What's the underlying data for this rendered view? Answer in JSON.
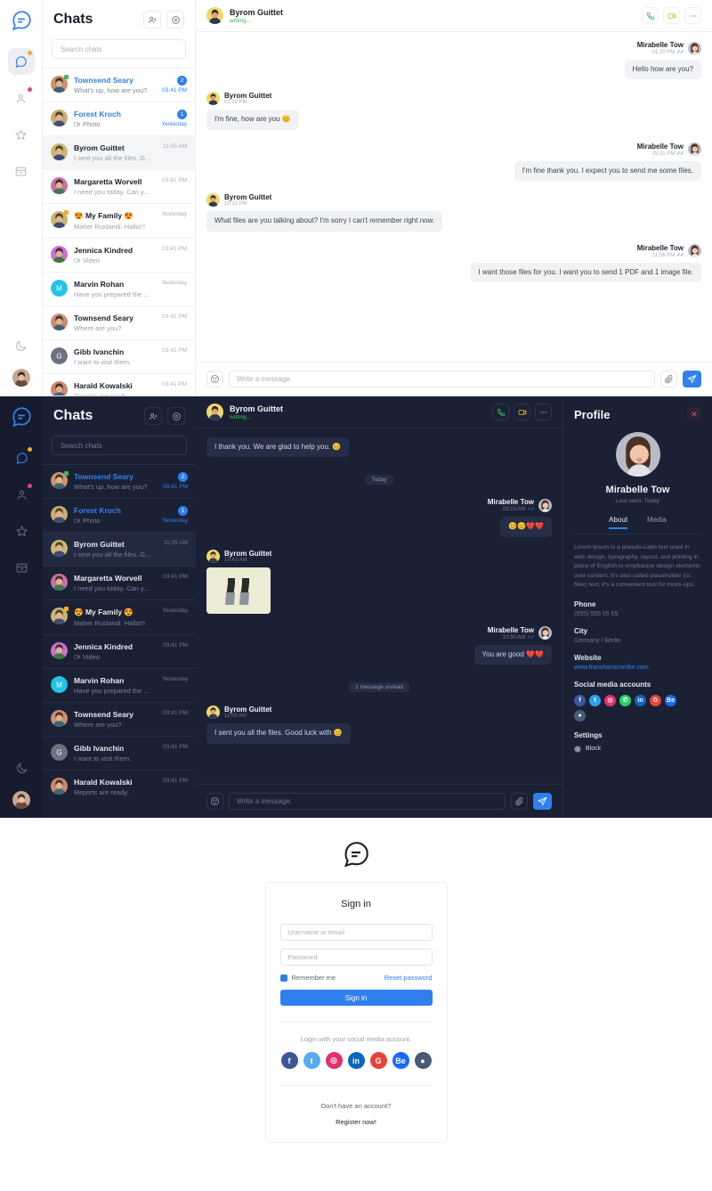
{
  "brand": {
    "accent": "#2f80ed",
    "online": "#3fb95c",
    "danger": "#e25563"
  },
  "rail": {
    "logo_icon": "chat-logo-icon",
    "items": [
      {
        "name": "chats",
        "icon": "chat-bubble-icon",
        "active": true,
        "badge": true,
        "badge_color": "#f2b01e"
      },
      {
        "name": "contacts",
        "icon": "user-icon",
        "active": false,
        "badge": true,
        "badge_color": "#e2457a"
      },
      {
        "name": "favorites",
        "icon": "star-icon",
        "active": false,
        "badge": false
      },
      {
        "name": "archive",
        "icon": "archive-icon",
        "active": false,
        "badge": false
      }
    ],
    "theme_toggle_icon": "moon-icon",
    "profile_avatar": "user-avatar"
  },
  "chatlist": {
    "title": "Chats",
    "action_add_icon": "add-contact-icon",
    "action_settings_icon": "settings-icon",
    "search_placeholder": "Search chats",
    "items": [
      {
        "name": "Townsend Seary",
        "preview": "What's up, how are you?",
        "time": "03:41 PM",
        "badge": "2",
        "unread": true,
        "status": true,
        "avatar_hue": 22,
        "initial": ""
      },
      {
        "name": "Forest Kroch",
        "preview": "Photo",
        "preview_icon": "camera-icon",
        "time": "Yesterday",
        "badge": "1",
        "unread": true,
        "status": false,
        "avatar_hue": 40,
        "initial": ""
      },
      {
        "name": "Byrom Guittet",
        "preview": "I sent you all the files. G...",
        "time": "11:05 AM",
        "badge": "",
        "unread": false,
        "active": true,
        "avatar_hue": 48,
        "initial": ""
      },
      {
        "name": "Margaretta Worvell",
        "preview": "I need you today. Can y...",
        "time": "03:41 PM",
        "badge": "",
        "unread": false,
        "avatar_hue": 330,
        "initial": ""
      },
      {
        "name": "😍 My Family 😍",
        "preview": "Maher Ruslandi: Hallo!!!",
        "time": "Yesterday",
        "badge": "",
        "unread": false,
        "avatar_hue": 45,
        "initial": "",
        "group": true
      },
      {
        "name": "Jennica Kindred",
        "preview": "Video",
        "preview_icon": "video-icon",
        "time": "03:41 PM",
        "badge": "",
        "unread": false,
        "avatar_hue": 300,
        "initial": ""
      },
      {
        "name": "Marvin Rohan",
        "preview": "Have you prepared the ...",
        "time": "Yesterday",
        "badge": "",
        "unread": false,
        "avatar_color": "#22c3e6",
        "initial": "M"
      },
      {
        "name": "Townsend Seary",
        "preview": "Where are you?",
        "time": "03:41 PM",
        "badge": "",
        "unread": false,
        "avatar_hue": 18,
        "initial": ""
      },
      {
        "name": "Gibb Ivanchin",
        "preview": "I want to visit them.",
        "time": "03:41 PM",
        "badge": "",
        "unread": false,
        "avatar_color": "#6b7280",
        "initial": "G"
      },
      {
        "name": "Harald Kowalski",
        "preview": "Reports are ready.",
        "time": "03:41 PM",
        "badge": "",
        "unread": false,
        "avatar_hue": 15,
        "initial": ""
      }
    ]
  },
  "conversation": {
    "peer_name": "Byrom Guittet",
    "peer_status": "writing...",
    "call_icon": "phone-icon",
    "video_icon": "video-camera-icon",
    "more_icon": "more-horizontal-icon",
    "composer": {
      "emoji_icon": "emoji-icon",
      "placeholder": "Write a message.",
      "attach_icon": "paperclip-icon",
      "send_icon": "send-icon"
    },
    "light_messages": [
      {
        "dir": "out",
        "who": "Mirabelle Tow",
        "time": "01:20 PM",
        "ticks": "✓✓",
        "text": "Hello how are you?"
      },
      {
        "dir": "in",
        "who": "Byrom Guittet",
        "time": "01:33 PM",
        "text": "I'm fine, how are you 😊"
      },
      {
        "dir": "out",
        "who": "Mirabelle Tow",
        "time": "05:31 PM",
        "ticks": "✓✓",
        "text": "I'm fine thank you. I expect you to send me some files."
      },
      {
        "dir": "in",
        "who": "Byrom Guittet",
        "time": "10:12 PM",
        "text": "What files are you talking about? I'm sorry I can't remember right now."
      },
      {
        "dir": "out",
        "who": "Mirabelle Tow",
        "time": "11:56 PM",
        "ticks": "✓✓",
        "text": "I want those files for you. I want you to send 1 PDF and 1 image file."
      }
    ],
    "dark_messages": [
      {
        "dir": "in",
        "text": "I thank you. We are glad to help you. 😊",
        "no_meta": true
      },
      {
        "divider": "Today"
      },
      {
        "dir": "out",
        "who": "Mirabelle Tow",
        "time": "09:23 AM",
        "ticks": "✓✓",
        "text": "😊😊❤️❤️"
      },
      {
        "dir": "in",
        "who": "Byrom Guittet",
        "time": "10:43 AM",
        "image": true
      },
      {
        "dir": "out",
        "who": "Mirabelle Tow",
        "time": "10:50 AM",
        "ticks": "✓✓",
        "text": "You are good ❤️❤️"
      },
      {
        "divider": "1 message unread"
      },
      {
        "dir": "in",
        "who": "Byrom Guittet",
        "time": "11:05 AM",
        "text": "I sent you all the files. Good luck with 😊"
      }
    ]
  },
  "profile": {
    "title": "Profile",
    "close_icon": "close-icon",
    "name": "Mirabelle Tow",
    "last_seen": "Last seen: Today",
    "tabs": [
      {
        "label": "About",
        "active": true
      },
      {
        "label": "Media",
        "active": false
      }
    ],
    "about": "Lorem ipsum is a pseudo-Latin text used in web design, typography, layout, and printing in place of English to emphasise design elements over content. It's also called placeholder (or filler) text, it's a convenient tool for mock-ups.",
    "fields": [
      {
        "label": "Phone",
        "value": "(555) 555 55 55",
        "link": false
      },
      {
        "label": "City",
        "value": "Germany / Berlin",
        "link": false
      },
      {
        "label": "Website",
        "value": "www.franshanscombe.com",
        "link": true
      }
    ],
    "social_label": "Social media accounts",
    "socials": [
      {
        "name": "facebook",
        "glyph": "f",
        "color": "#3b5998"
      },
      {
        "name": "twitter",
        "glyph": "t",
        "color": "#2aa3ef"
      },
      {
        "name": "instagram",
        "glyph": "◎",
        "color": "#e1306c"
      },
      {
        "name": "whatsapp",
        "glyph": "✆",
        "color": "#25d366"
      },
      {
        "name": "linkedin",
        "glyph": "in",
        "color": "#0a66c2"
      },
      {
        "name": "google",
        "glyph": "G",
        "color": "#ea4335"
      },
      {
        "name": "behance",
        "glyph": "Be",
        "color": "#1769ff"
      },
      {
        "name": "dribbble",
        "glyph": "●",
        "color": "#4a5a78"
      }
    ],
    "settings_label": "Settings",
    "block_label": "Block"
  },
  "signin": {
    "logo_icon": "chat-logo-icon",
    "title": "Sign in",
    "username_placeholder": "Username or email",
    "password_placeholder": "Password",
    "remember_label": "Remember me",
    "reset_label": "Reset password",
    "submit_label": "Sign in",
    "social_label": "Login with your social media account.",
    "socials": [
      {
        "name": "facebook",
        "glyph": "f",
        "color": "#3b5998"
      },
      {
        "name": "twitter",
        "glyph": "t",
        "color": "#55acee"
      },
      {
        "name": "instagram",
        "glyph": "◎",
        "color": "#e1306c"
      },
      {
        "name": "linkedin",
        "glyph": "in",
        "color": "#0a66c2"
      },
      {
        "name": "google",
        "glyph": "G",
        "color": "#ea4335"
      },
      {
        "name": "behance",
        "glyph": "Be",
        "color": "#1769ff"
      },
      {
        "name": "dribbble",
        "glyph": "●",
        "color": "#4a5a78"
      }
    ],
    "no_account": "Don't have an account?",
    "register_label": "Register now!"
  }
}
